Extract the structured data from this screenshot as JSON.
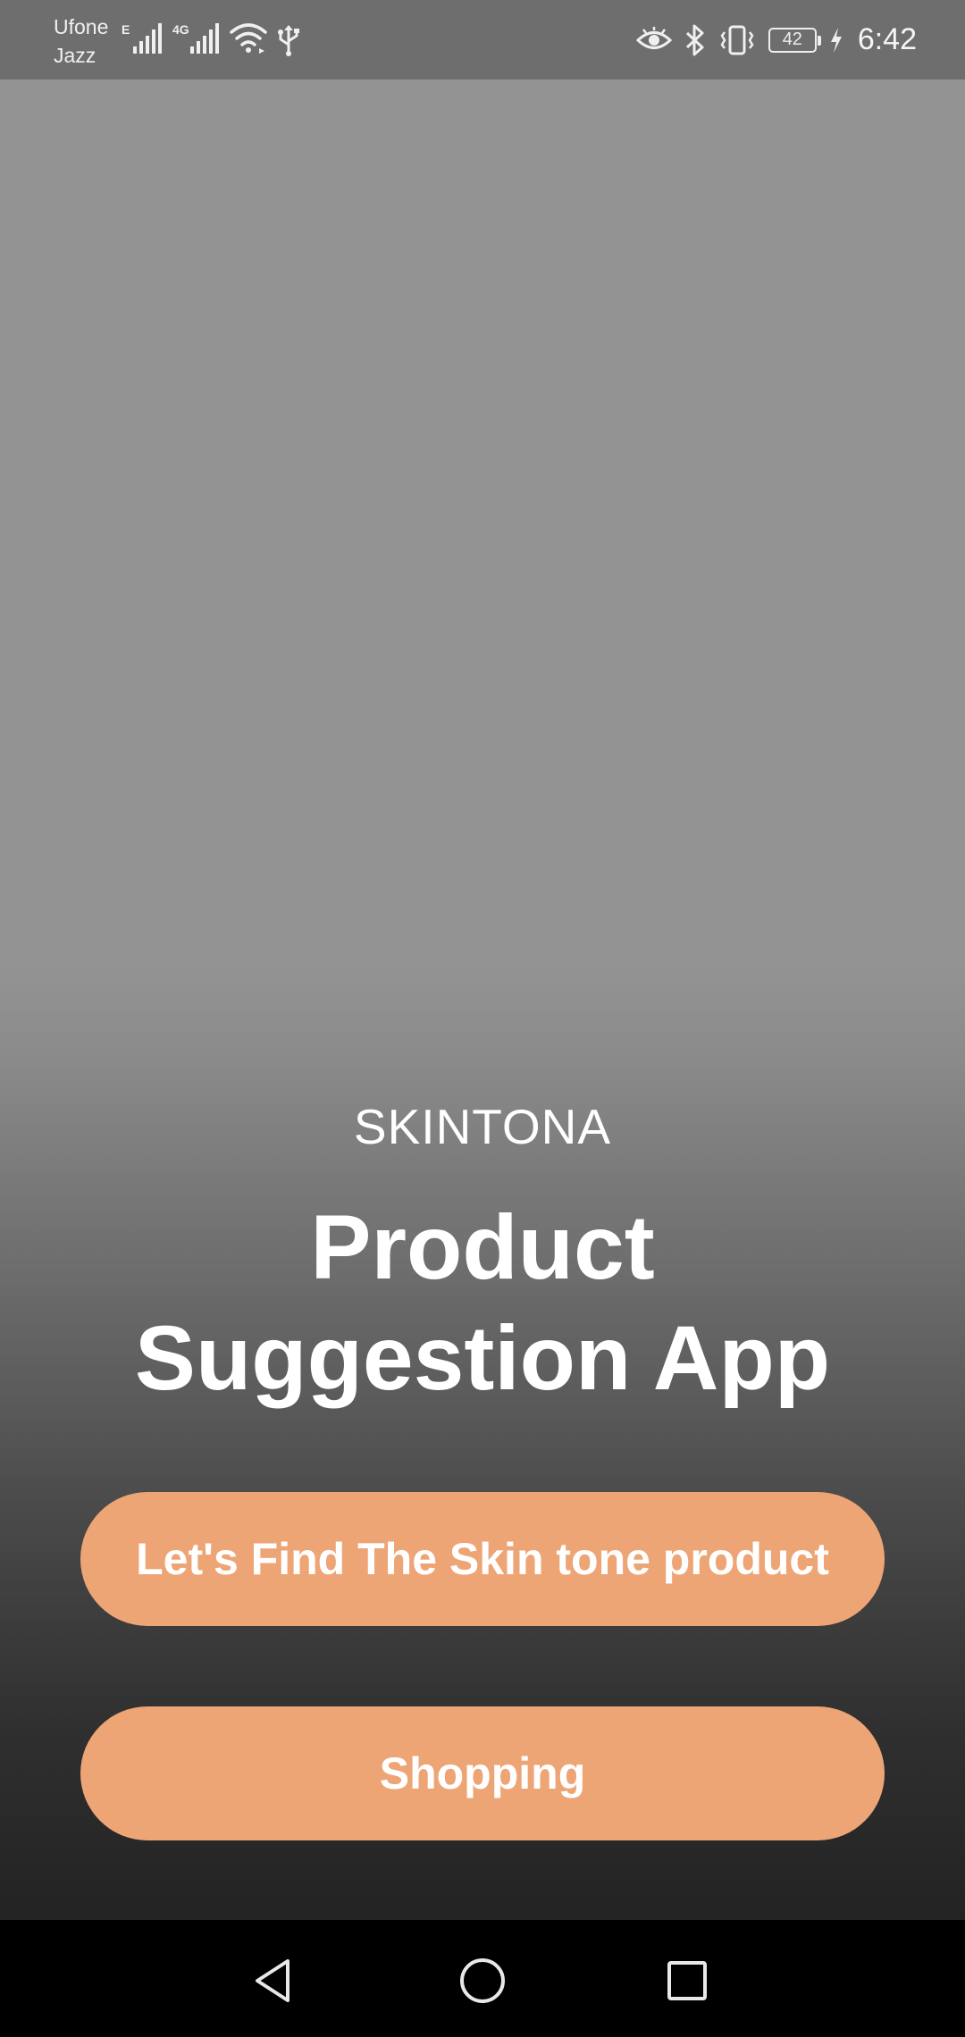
{
  "status_bar": {
    "carrier_1": "Ufone",
    "carrier_2": "Jazz",
    "network_1": "E",
    "network_2": "4G",
    "battery_level": "42",
    "time": "6:42",
    "icons": [
      "signal-icon",
      "signal-icon",
      "wifi-icon",
      "usb-icon",
      "eye-icon",
      "bluetooth-icon",
      "vibrate-icon",
      "battery-icon",
      "charging-icon"
    ]
  },
  "app": {
    "brand": "SKINTONA",
    "title_line_1": "Product",
    "title_line_2": "Suggestion App",
    "buttons": {
      "find_label": "Let's Find The Skin tone product",
      "shopping_label": "Shopping"
    },
    "colors": {
      "button_bg": "#eea576",
      "button_text": "#ffffff"
    }
  },
  "nav_bar": {
    "icons": [
      "back-icon",
      "home-icon",
      "recents-icon"
    ]
  }
}
